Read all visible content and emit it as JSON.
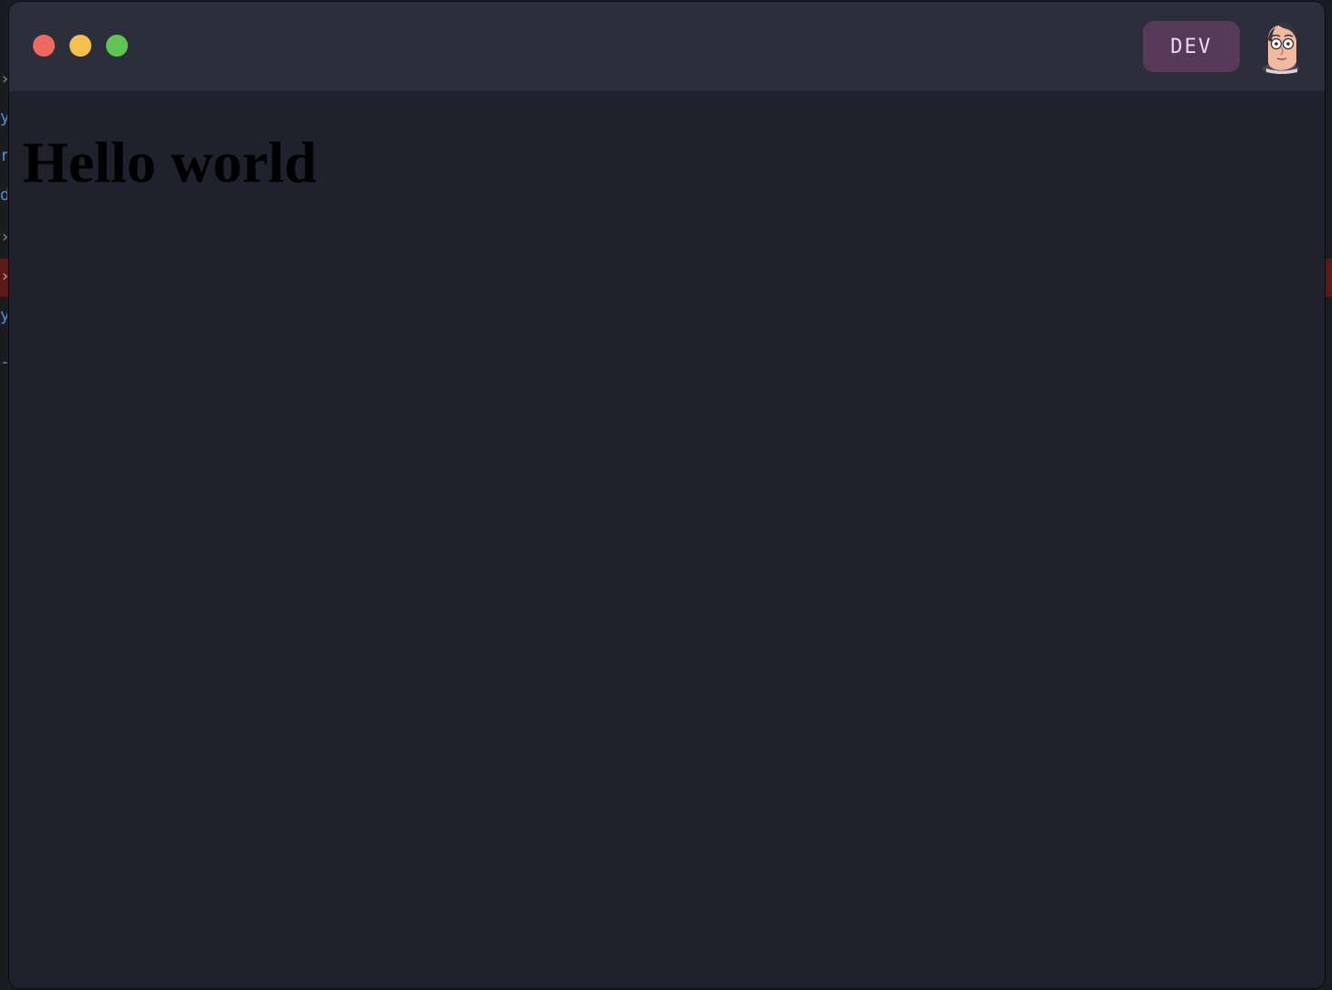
{
  "window": {
    "controls": {
      "close": "close-icon",
      "minimize": "minimize-icon",
      "zoom": "zoom-icon"
    },
    "env_badge": "DEV",
    "avatar_icon": "cartoon-face-avatar-icon"
  },
  "page": {
    "heading": "Hello world"
  },
  "colors": {
    "titlebar": "#2c2f3b",
    "content_bg": "#1f222c",
    "badge_bg": "#573a5a",
    "close": "#ec6a5e",
    "minimize": "#f4bf4f",
    "zoom": "#61c554"
  }
}
